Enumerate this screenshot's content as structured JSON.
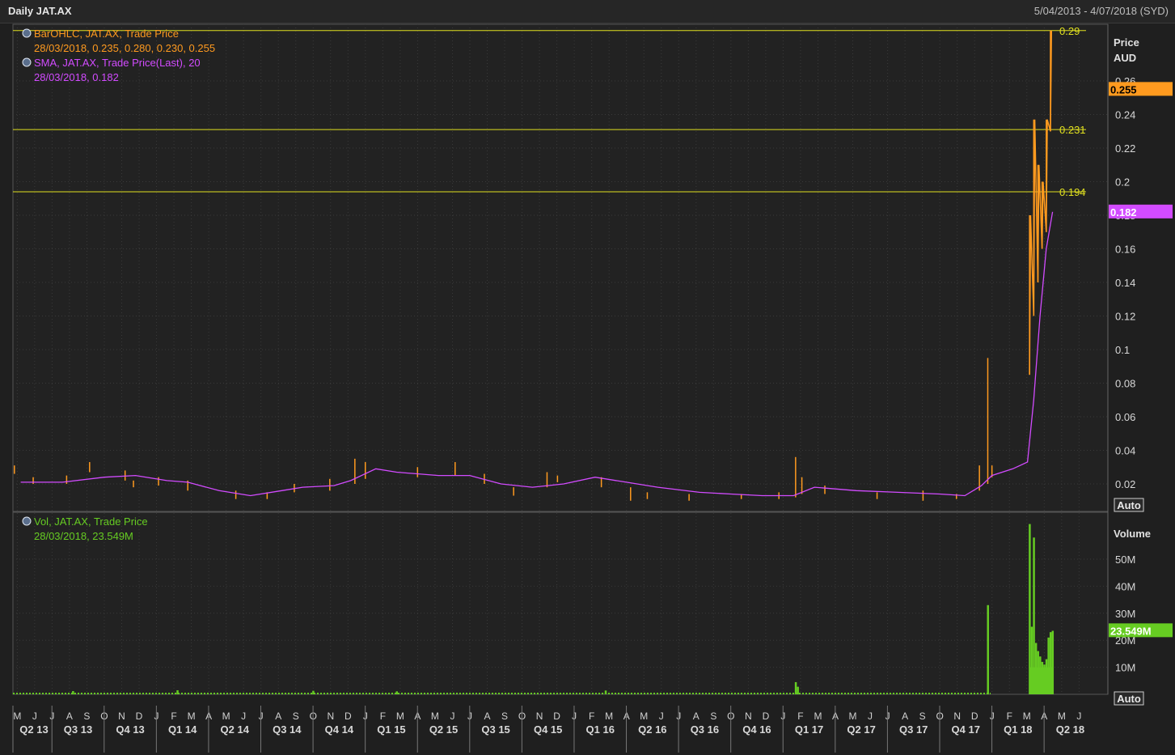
{
  "window": {
    "title": "Daily JAT.AX",
    "date_range": "5/04/2013 - 4/07/2018 (SYD)"
  },
  "chart_data": [
    {
      "type": "line",
      "panel": "price",
      "axis_title_line1": "Price",
      "axis_title_line2": "AUD",
      "auto_label": "Auto",
      "ylim": [
        0.005,
        0.295
      ],
      "yticks": [
        "0.26",
        "0.24",
        "0.22",
        "0.2",
        "0.18",
        "0.16",
        "0.14",
        "0.12",
        "0.1",
        "0.08",
        "0.06",
        "0.04",
        "0.02"
      ],
      "ytick_values": [
        0.26,
        0.24,
        0.22,
        0.2,
        0.18,
        0.16,
        0.14,
        0.12,
        0.1,
        0.08,
        0.06,
        0.04,
        0.02
      ],
      "legend": [
        {
          "title": "BarOHLC, JAT.AX, Trade Price",
          "detail": "28/03/2018, 0.235, 0.280, 0.230, 0.255",
          "color": "#ff9a1f"
        },
        {
          "title": "SMA, JAT.AX, Trade Price(Last),  20",
          "detail": "28/03/2018, 0.182",
          "color": "#d24bff"
        }
      ],
      "last_price": {
        "value": 0.255,
        "label": "0.255",
        "color": "#ff9a1f"
      },
      "last_sma": {
        "value": 0.182,
        "label": "0.182",
        "color": "#d24bff"
      },
      "hlines": [
        {
          "value": 0.29,
          "label": "0.29"
        },
        {
          "value": 0.231,
          "label": "0.231"
        },
        {
          "value": 0.194,
          "label": "0.194"
        }
      ],
      "series": [
        {
          "name": "SMA, JAT.AX, Trade Price(Last),  20",
          "x": [
            2013.3,
            2013.5,
            2013.7,
            2013.85,
            2014.0,
            2014.1,
            2014.25,
            2014.4,
            2014.55,
            2014.65,
            2014.8,
            2014.88,
            2015.0,
            2015.1,
            2015.3,
            2015.45,
            2015.6,
            2015.75,
            2015.9,
            2016.05,
            2016.2,
            2016.35,
            2016.55,
            2016.7,
            2016.85,
            2017.0,
            2017.1,
            2017.3,
            2017.5,
            2017.7,
            2017.82,
            2017.9,
            2017.95,
            2018.05,
            2018.12,
            2018.15,
            2018.18,
            2018.21,
            2018.24
          ],
          "y": [
            0.021,
            0.021,
            0.024,
            0.025,
            0.022,
            0.021,
            0.016,
            0.013,
            0.016,
            0.018,
            0.019,
            0.022,
            0.029,
            0.027,
            0.025,
            0.025,
            0.02,
            0.018,
            0.02,
            0.024,
            0.021,
            0.018,
            0.015,
            0.014,
            0.013,
            0.013,
            0.018,
            0.016,
            0.015,
            0.014,
            0.013,
            0.019,
            0.025,
            0.029,
            0.033,
            0.07,
            0.12,
            0.16,
            0.182
          ]
        },
        {
          "name": "BarOHLC, JAT.AX, Trade Price",
          "bars": [
            [
              2013.27,
              0.031,
              0.026
            ],
            [
              2013.36,
              0.024,
              0.02
            ],
            [
              2013.52,
              0.025,
              0.02
            ],
            [
              2013.63,
              0.033,
              0.027
            ],
            [
              2013.8,
              0.028,
              0.022
            ],
            [
              2013.84,
              0.022,
              0.018
            ],
            [
              2013.96,
              0.024,
              0.019
            ],
            [
              2014.1,
              0.022,
              0.016
            ],
            [
              2014.33,
              0.016,
              0.011
            ],
            [
              2014.48,
              0.015,
              0.011
            ],
            [
              2014.61,
              0.02,
              0.015
            ],
            [
              2014.78,
              0.023,
              0.016
            ],
            [
              2014.9,
              0.035,
              0.02
            ],
            [
              2014.95,
              0.033,
              0.023
            ],
            [
              2015.2,
              0.03,
              0.024
            ],
            [
              2015.38,
              0.033,
              0.025
            ],
            [
              2015.52,
              0.026,
              0.02
            ],
            [
              2015.66,
              0.018,
              0.013
            ],
            [
              2015.82,
              0.027,
              0.018
            ],
            [
              2015.87,
              0.025,
              0.021
            ],
            [
              2016.08,
              0.024,
              0.018
            ],
            [
              2016.22,
              0.018,
              0.01
            ],
            [
              2016.3,
              0.015,
              0.011
            ],
            [
              2016.5,
              0.014,
              0.01
            ],
            [
              2016.75,
              0.014,
              0.011
            ],
            [
              2016.93,
              0.015,
              0.011
            ],
            [
              2017.01,
              0.036,
              0.012
            ],
            [
              2017.04,
              0.024,
              0.014
            ],
            [
              2017.15,
              0.019,
              0.014
            ],
            [
              2017.4,
              0.015,
              0.011
            ],
            [
              2017.62,
              0.016,
              0.01
            ],
            [
              2017.78,
              0.014,
              0.011
            ],
            [
              2017.89,
              0.031,
              0.016
            ],
            [
              2017.93,
              0.095,
              0.02
            ],
            [
              2017.95,
              0.031,
              0.024
            ],
            [
              2018.13,
              0.18,
              0.085
            ],
            [
              2018.15,
              0.237,
              0.12
            ],
            [
              2018.17,
              0.21,
              0.14
            ],
            [
              2018.19,
              0.2,
              0.16
            ],
            [
              2018.21,
              0.237,
              0.17
            ],
            [
              2018.23,
              0.29,
              0.23
            ]
          ]
        }
      ]
    },
    {
      "type": "bar",
      "panel": "volume",
      "axis_title": "Volume",
      "auto_label": "Auto",
      "ylim": [
        0,
        64
      ],
      "yticks": [
        "50M",
        "40M",
        "30M",
        "20M",
        "10M"
      ],
      "ytick_values": [
        50,
        40,
        30,
        20,
        10
      ],
      "legend": [
        {
          "title": "Vol, JAT.AX, Trade Price",
          "detail": "28/03/2018, 23.549M",
          "color": "#66cc22"
        }
      ],
      "last_volume": {
        "value": 23.549,
        "label": "23.549M",
        "color": "#66cc22"
      },
      "series": [
        {
          "name": "Vol, JAT.AX, Trade Price",
          "x": [
            2013.55,
            2014.05,
            2014.7,
            2015.1,
            2016.1,
            2017.01,
            2017.02,
            2017.93,
            2018.13,
            2018.14,
            2018.15,
            2018.16,
            2018.17,
            2018.18,
            2018.19,
            2018.2,
            2018.21,
            2018.22,
            2018.23,
            2018.24
          ],
          "y": [
            1.2,
            1.5,
            1.3,
            1.1,
            1.4,
            4.5,
            2.8,
            33,
            63,
            25,
            58,
            19,
            16,
            14,
            12,
            11,
            13,
            21,
            23,
            23.5
          ]
        }
      ]
    }
  ],
  "xaxis": {
    "months": [
      "M",
      "J",
      "J",
      "A",
      "S",
      "O",
      "N",
      "D",
      "J",
      "F",
      "M",
      "A",
      "M",
      "J",
      "J",
      "A",
      "S",
      "O",
      "N",
      "D",
      "J",
      "F",
      "M",
      "A",
      "M",
      "J",
      "J",
      "A",
      "S",
      "O",
      "N",
      "D",
      "J",
      "F",
      "M",
      "A",
      "M",
      "J",
      "J",
      "A",
      "S",
      "O",
      "N",
      "D",
      "J",
      "F",
      "M",
      "A",
      "M",
      "J",
      "J",
      "A",
      "S",
      "O",
      "N",
      "D",
      "J",
      "F",
      "M",
      "A",
      "M",
      "J"
    ],
    "quarters": [
      "Q2 13",
      "Q3 13",
      "Q4 13",
      "Q1 14",
      "Q2 14",
      "Q3 14",
      "Q4 14",
      "Q1 15",
      "Q2 15",
      "Q3 15",
      "Q4 15",
      "Q1 16",
      "Q2 16",
      "Q3 16",
      "Q4 16",
      "Q1 17",
      "Q2 17",
      "Q3 17",
      "Q4 17",
      "Q1 18",
      "Q2 18"
    ]
  },
  "colors": {
    "background": "#1f1f1f",
    "grid": "#3a3a3a",
    "hline": "#e0e020",
    "price": "#ff9a1f",
    "sma": "#d24bff",
    "volume": "#66cc22"
  }
}
